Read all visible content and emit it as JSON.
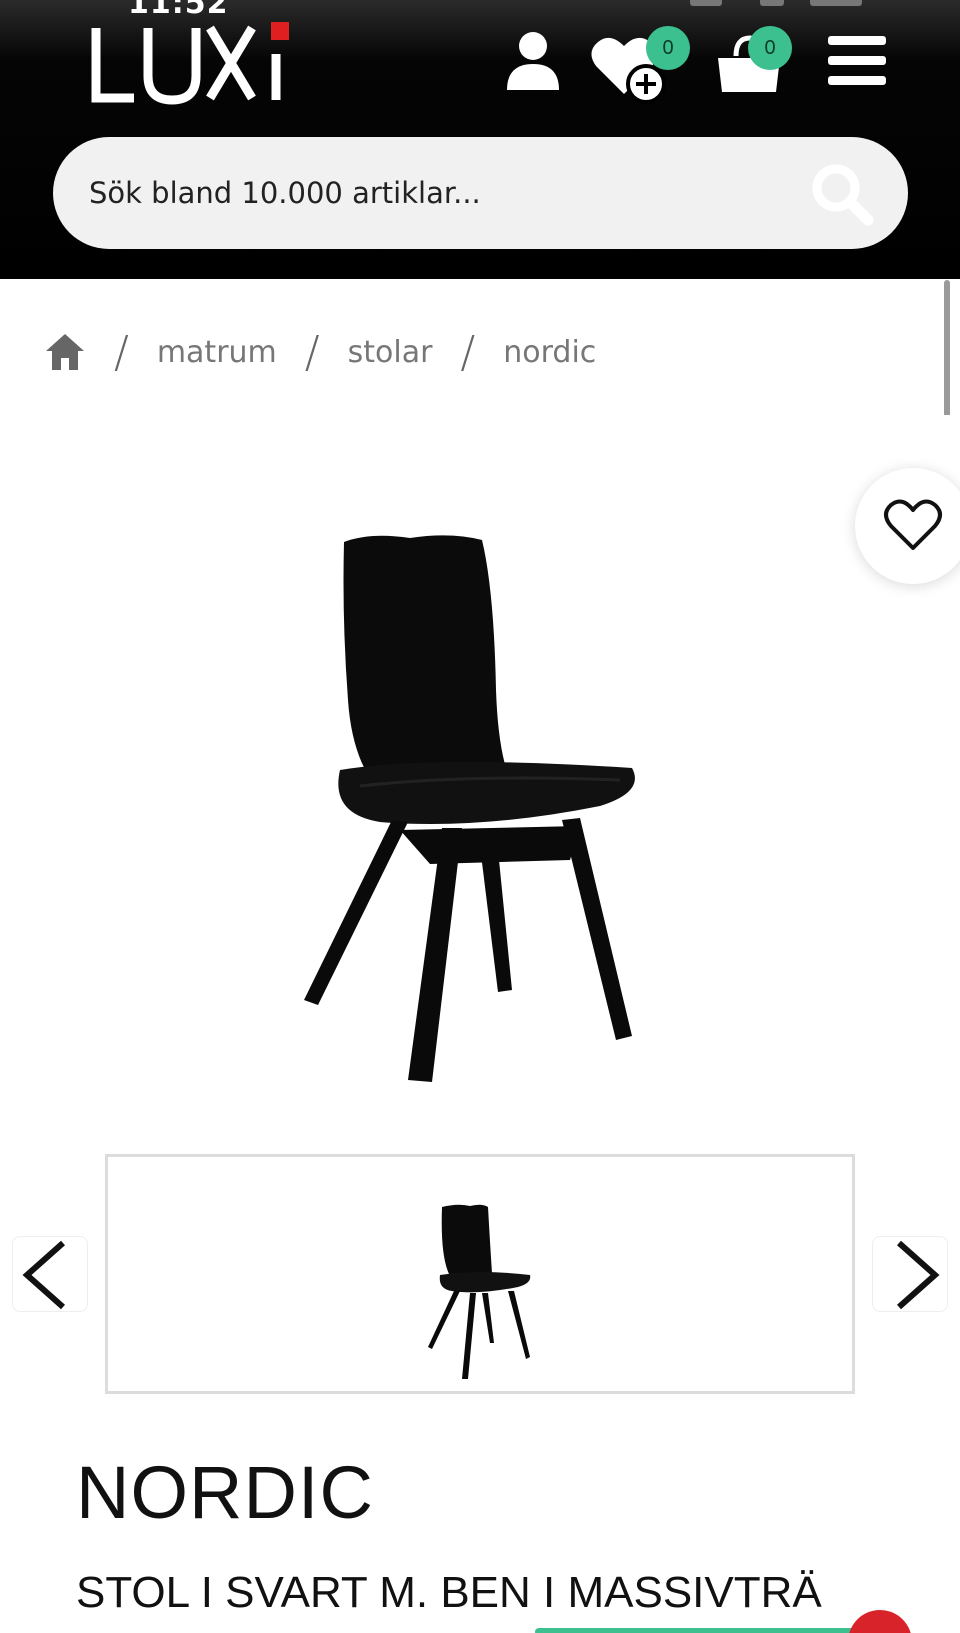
{
  "status_bar": {
    "time": "11:52"
  },
  "header": {
    "logo_text": "LUXi",
    "wishlist_count": "0",
    "cart_count": "0",
    "search": {
      "placeholder": "Sök bland 10.000 artiklar..."
    }
  },
  "breadcrumb": {
    "items": [
      "matrum",
      "stolar",
      "nordic"
    ],
    "separator": "/"
  },
  "product": {
    "name": "NORDIC",
    "subtitle": "STOL I SVART M. BEN I MASSIVTRÄ"
  },
  "colors": {
    "header_bg": "#000000",
    "badge": "#3cc08f",
    "accent_red": "#d8232a"
  }
}
